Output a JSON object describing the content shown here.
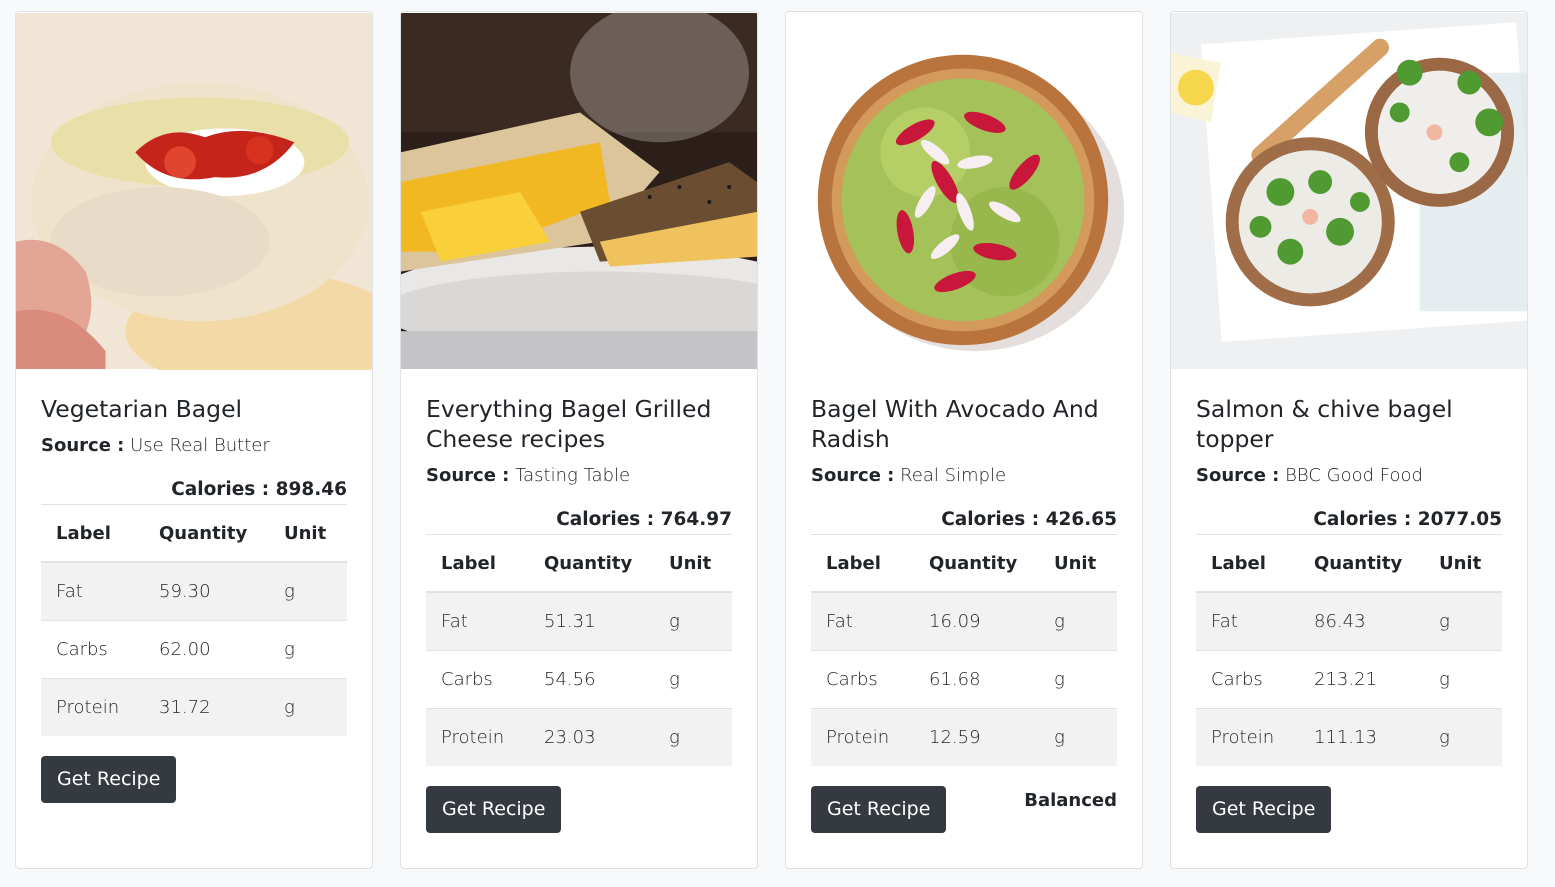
{
  "cards": [
    {
      "title": "Vegetarian Bagel",
      "source_label": "Source :",
      "source": "Use Real Butter",
      "calories_text": "Calories : 898.46",
      "headers": [
        "Label",
        "Quantity",
        "Unit"
      ],
      "rows": [
        {
          "label": "Fat",
          "quantity": "59.30",
          "unit": "g"
        },
        {
          "label": "Carbs",
          "quantity": "62.00",
          "unit": "g"
        },
        {
          "label": "Protein",
          "quantity": "31.72",
          "unit": "g"
        }
      ],
      "button": "Get Recipe",
      "tag": ""
    },
    {
      "title": "Everything Bagel Grilled Cheese recipes",
      "source_label": "Source :",
      "source": "Tasting Table",
      "calories_text": "Calories : 764.97",
      "headers": [
        "Label",
        "Quantity",
        "Unit"
      ],
      "rows": [
        {
          "label": "Fat",
          "quantity": "51.31",
          "unit": "g"
        },
        {
          "label": "Carbs",
          "quantity": "54.56",
          "unit": "g"
        },
        {
          "label": "Protein",
          "quantity": "23.03",
          "unit": "g"
        }
      ],
      "button": "Get Recipe",
      "tag": ""
    },
    {
      "title": "Bagel With Avocado And Radish",
      "source_label": "Source :",
      "source": "Real Simple",
      "calories_text": "Calories : 426.65",
      "headers": [
        "Label",
        "Quantity",
        "Unit"
      ],
      "rows": [
        {
          "label": "Fat",
          "quantity": "16.09",
          "unit": "g"
        },
        {
          "label": "Carbs",
          "quantity": "61.68",
          "unit": "g"
        },
        {
          "label": "Protein",
          "quantity": "12.59",
          "unit": "g"
        }
      ],
      "button": "Get Recipe",
      "tag": "Balanced"
    },
    {
      "title": "Salmon & chive bagel topper",
      "source_label": "Source :",
      "source": "BBC Good Food",
      "calories_text": "Calories : 2077.05",
      "headers": [
        "Label",
        "Quantity",
        "Unit"
      ],
      "rows": [
        {
          "label": "Fat",
          "quantity": "86.43",
          "unit": "g"
        },
        {
          "label": "Carbs",
          "quantity": "213.21",
          "unit": "g"
        },
        {
          "label": "Protein",
          "quantity": "111.13",
          "unit": "g"
        }
      ],
      "button": "Get Recipe",
      "tag": ""
    }
  ],
  "colors": {
    "button_bg": "#343a40",
    "page_bg": "#f8f9fa",
    "striped_row": "#f2f2f2"
  }
}
